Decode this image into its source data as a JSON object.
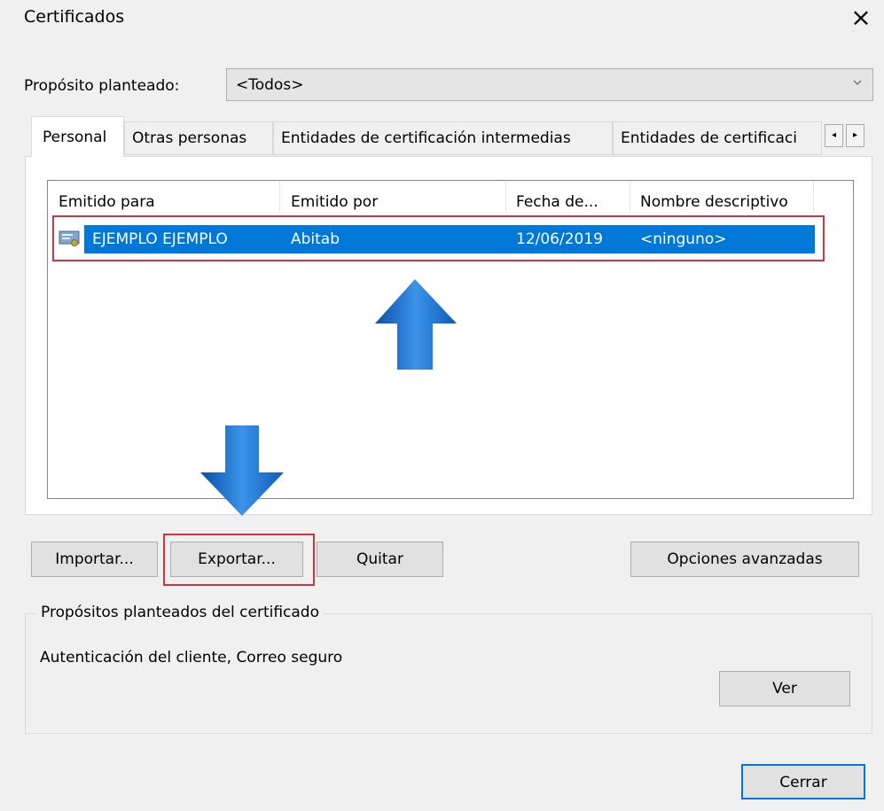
{
  "window": {
    "title": "Certificados",
    "close_glyph": "×"
  },
  "purpose": {
    "label": "Propósito planteado:",
    "value": "<Todos>"
  },
  "tabs": [
    {
      "label": "Personal",
      "active": true
    },
    {
      "label": "Otras personas"
    },
    {
      "label": "Entidades de certificación intermedias"
    },
    {
      "label": "Entidades de certificaci"
    }
  ],
  "tab_scroll": {
    "left": "◂",
    "right": "▸"
  },
  "table": {
    "columns": [
      "Emitido para",
      "Emitido por",
      "Fecha de...",
      "Nombre descriptivo"
    ],
    "rows": [
      {
        "issued_to": "EJEMPLO EJEMPLO",
        "issued_by": "Abitab",
        "expiry": "12/06/2019",
        "friendly_name": "<ninguno>",
        "selected": true
      }
    ]
  },
  "buttons": {
    "import": "Importar...",
    "export": "Exportar...",
    "remove": "Quitar",
    "advanced": "Opciones avanzadas",
    "view": "Ver",
    "close": "Cerrar"
  },
  "purposes_group": {
    "label": "Propósitos planteados del certificado",
    "value": "Autenticación del cliente, Correo seguro"
  },
  "colors": {
    "selection": "#0078d7",
    "highlight": "#c8373d",
    "arrow": "#1a6fd1"
  },
  "icons": [
    "close-icon",
    "chevron-down-icon",
    "certificate-icon",
    "arrow-up-icon",
    "arrow-down-icon"
  ]
}
